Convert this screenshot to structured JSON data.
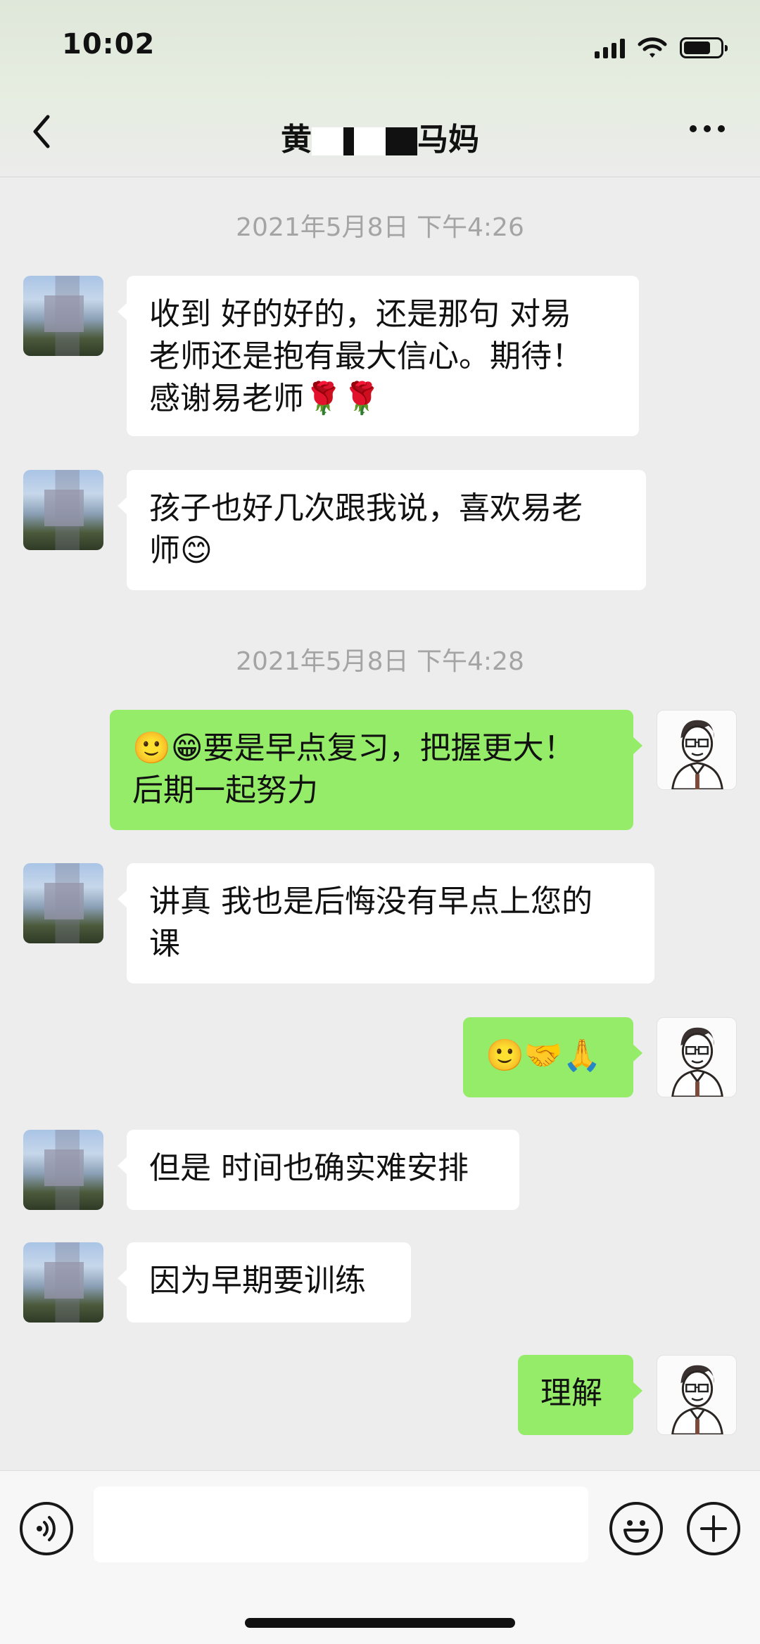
{
  "status_bar": {
    "time": "10:02"
  },
  "header": {
    "title_prefix": "黄",
    "title_suffix": "马妈"
  },
  "messages": [
    {
      "type": "timestamp",
      "text": "2021年5月8日 下午4:26"
    },
    {
      "type": "received",
      "text": "收到 好的好的，还是那句 对易\n老师还是抱有最大信心。期待！\n感谢易老师🌹🌹"
    },
    {
      "type": "received",
      "text": "孩子也好几次跟我说，喜欢易老\n师😊"
    },
    {
      "type": "timestamp",
      "text": "2021年5月8日 下午4:28"
    },
    {
      "type": "sent",
      "text": "🙂😁要是早点复习，把握更大！\n后期一起努力"
    },
    {
      "type": "received",
      "text": "讲真 我也是后悔没有早点上您的\n课"
    },
    {
      "type": "sent",
      "text": "🙂🤝🙏"
    },
    {
      "type": "received",
      "text": "但是 时间也确实难安排"
    },
    {
      "type": "received",
      "text": "因为早期要训练"
    },
    {
      "type": "sent",
      "text": "理解"
    }
  ],
  "input": {
    "value": ""
  },
  "icons": {
    "back": "chevron-left-icon",
    "more": "more-dots-icon",
    "voice": "voice-icon",
    "emoji": "emoji-icon",
    "plus": "plus-icon"
  },
  "colors": {
    "sent_bubble": "#95ec69",
    "received_bubble": "#ffffff",
    "background": "#ededed"
  }
}
